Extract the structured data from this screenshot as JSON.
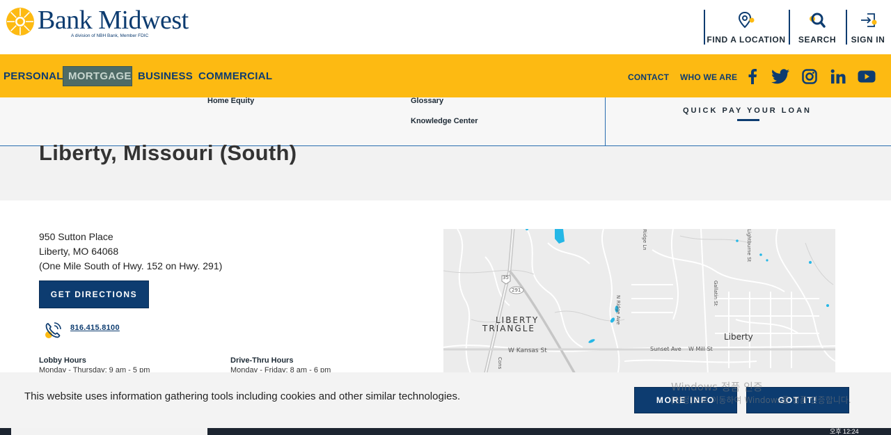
{
  "brand": {
    "name": "Bank Midwest",
    "tagline": "A division of NBH Bank, Member FDIC"
  },
  "utility": {
    "location": "FIND A LOCATION",
    "search": "SEARCH",
    "signin": "SIGN IN"
  },
  "nav": {
    "items": [
      "PERSONAL",
      "MORTGAGE",
      "BUSINESS",
      "COMMERCIAL"
    ],
    "active": "MORTGAGE",
    "right": [
      "CONTACT",
      "WHO WE ARE"
    ],
    "social": [
      "facebook-icon",
      "twitter-icon",
      "instagram-icon",
      "linkedin-icon",
      "youtube-icon"
    ]
  },
  "dropdown": {
    "col1": [
      "Home Equity"
    ],
    "col2": [
      "Glossary",
      "Knowledge Center"
    ],
    "quickpay": "QUICK PAY YOUR LOAN"
  },
  "page": {
    "title": "Liberty, Missouri (South)"
  },
  "location": {
    "street": "950 Sutton Place",
    "city": "Liberty, MO 64068",
    "note": "(One Mile South of Hwy. 152 on Hwy. 291)",
    "directions_label": "GET DIRECTIONS",
    "phone": "816.415.8100",
    "lobby_title": "Lobby Hours",
    "lobby_text": "Monday - Thursday: 9 am - 5 pm",
    "drive_title": "Drive-Thru Hours",
    "drive_text": "Monday - Friday: 8 am - 6 pm"
  },
  "map": {
    "labels": {
      "triangle1": "LIBERTY",
      "triangle2": "TRIANGLE",
      "liberty": "Liberty",
      "kansas": "W Kansas St",
      "sunset": "Sunset Ave",
      "mill": "W Mill St",
      "ridge": "N Ridge Ave",
      "gallatin": "Gallatin St",
      "lightburne": "Lightburne St",
      "ridgelane": "Ridge Ln",
      "cons": "Cons",
      "i35": "35",
      "hwy291": "291"
    }
  },
  "cookie": {
    "text": "This website uses information gathering tools including cookies and other similar technologies.",
    "more": "MORE INFO",
    "got": "GOT IT!"
  },
  "windows": {
    "line1": "Windows 정품 인증",
    "line2": "[설정]으로 이동하여 Windows를 정품 인증합니다.",
    "clock": "오후 12:24"
  },
  "colors": {
    "navy": "#0d3c70",
    "gold": "#fdba12",
    "active_nav": "#4e6b66"
  }
}
